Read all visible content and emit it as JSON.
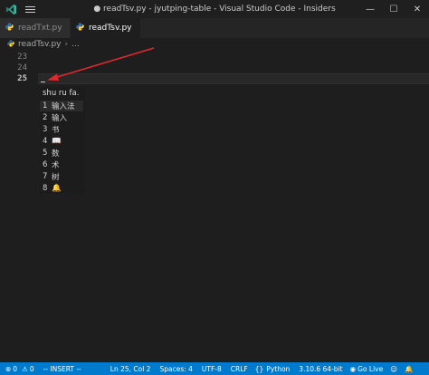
{
  "window": {
    "title": "● readTsv.py - jyutping-table - Visual Studio Code - Insiders",
    "controls": [
      "—",
      "☐",
      "✕"
    ]
  },
  "tabs": [
    {
      "label": "readTxt.py",
      "active": false
    },
    {
      "label": "readTsv.py",
      "active": true,
      "dirty": true
    }
  ],
  "breadcrumb": {
    "file": "readTsv.py",
    "more": "..."
  },
  "editor": {
    "line_numbers": [
      "23",
      "24",
      "25"
    ],
    "current_line": "25"
  },
  "ime": {
    "input": "shu ru fa.",
    "candidates": [
      {
        "num": "1",
        "text": "输入法"
      },
      {
        "num": "2",
        "text": "输入"
      },
      {
        "num": "3",
        "text": "书"
      },
      {
        "num": "4",
        "text": "📖"
      },
      {
        "num": "5",
        "text": "数"
      },
      {
        "num": "6",
        "text": "术"
      },
      {
        "num": "7",
        "text": "树"
      },
      {
        "num": "8",
        "text": "🔔"
      }
    ],
    "selected_index": 0
  },
  "statusbar": {
    "errors": "0",
    "warnings": "0",
    "mode": "-- INSERT --",
    "position": "Ln 25, Col 2",
    "spaces": "Spaces: 4",
    "encoding": "UTF-8",
    "eol": "CRLF",
    "language": "Python",
    "interpreter": "3.10.6 64-bit",
    "go_live": "Go Live"
  },
  "colors": {
    "accent": "#007acc",
    "annotation_arrow": "#e0282e",
    "python_blue": "#3572a5",
    "python_yellow": "#ffd43b"
  }
}
